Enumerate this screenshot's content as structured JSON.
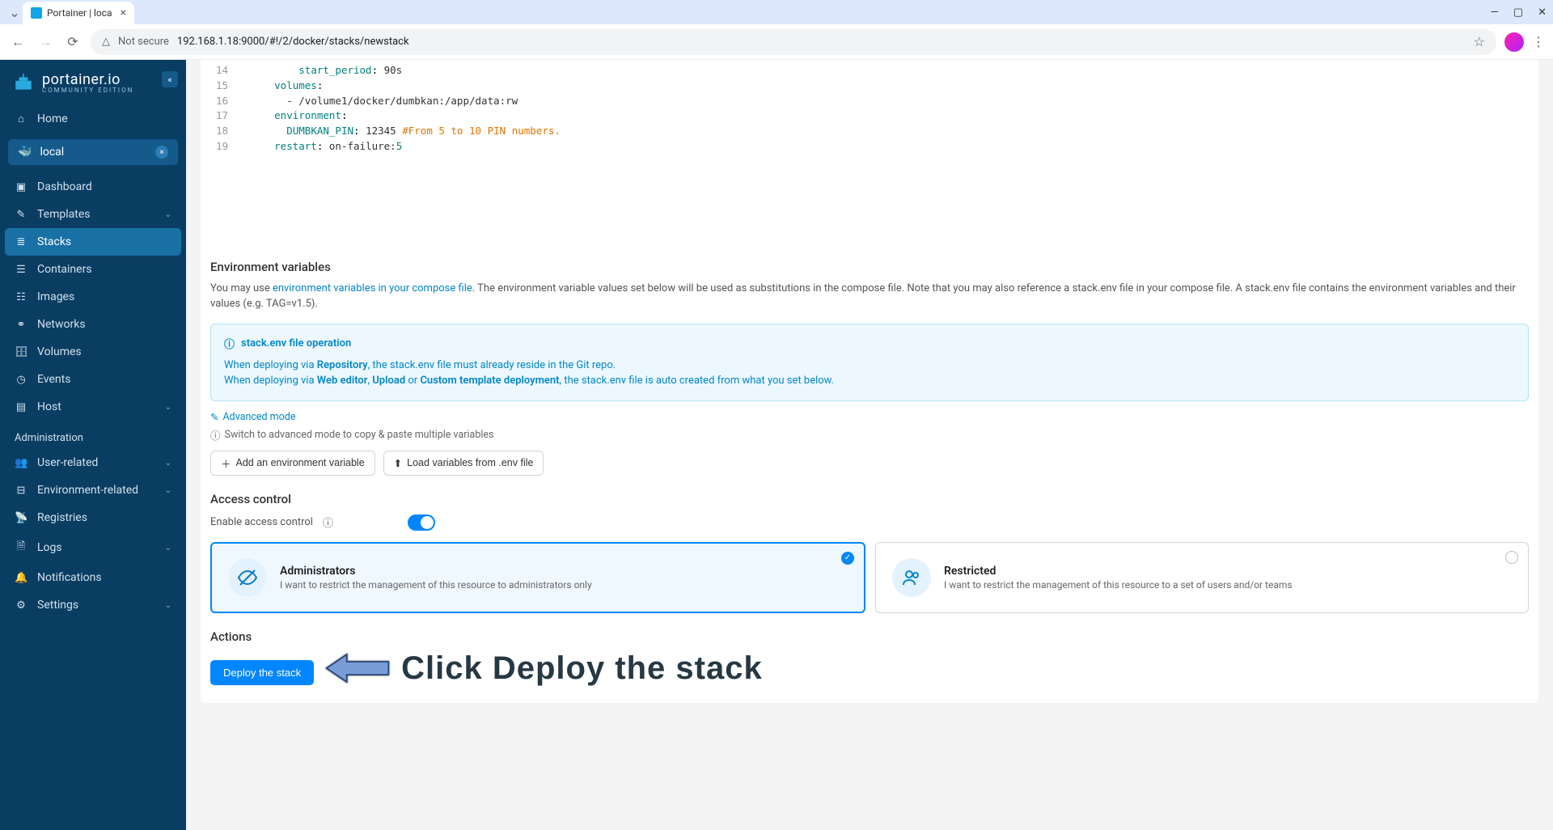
{
  "browser": {
    "tab_title": "Portainer | loca",
    "url_prefix": "Not secure",
    "url": "192.168.1.18:9000/#!/2/docker/stacks/newstack"
  },
  "logo": {
    "name": "portainer.io",
    "sub": "COMMUNITY EDITION"
  },
  "nav": {
    "home": "Home",
    "env": "local",
    "dashboard": "Dashboard",
    "templates": "Templates",
    "stacks": "Stacks",
    "containers": "Containers",
    "images": "Images",
    "networks": "Networks",
    "volumes": "Volumes",
    "events": "Events",
    "host": "Host",
    "admin_label": "Administration",
    "user_related": "User-related",
    "env_related": "Environment-related",
    "registries": "Registries",
    "logs": "Logs",
    "notifications": "Notifications",
    "settings": "Settings"
  },
  "code": [
    {
      "n": "14",
      "indent": "          ",
      "key": "start_period",
      "val": " 90s"
    },
    {
      "n": "15",
      "indent": "      ",
      "key": "volumes",
      "val": ""
    },
    {
      "n": "16",
      "indent": "        ",
      "raw": "- /volume1/docker/dumbkan:/app/data:rw"
    },
    {
      "n": "17",
      "indent": "      ",
      "key": "environment",
      "val": ""
    },
    {
      "n": "18",
      "indent": "        ",
      "key": "DUMBKAN_PIN",
      "val": " 12345 ",
      "cmt": "#From 5 to 10 PIN numbers."
    },
    {
      "n": "19",
      "indent": "      ",
      "key": "restart",
      "val": " on-failure:",
      "num": "5"
    }
  ],
  "env_section": {
    "title": "Environment variables",
    "help_pre": "You may use ",
    "help_link": "environment variables in your compose file",
    "help_post": ". The environment variable values set below will be used as substitutions in the compose file. Note that you may also reference a stack.env file in your compose file. A stack.env file contains the environment variables and their values (e.g. TAG=v1.5).",
    "info_title": "stack.env file operation",
    "info_l1_a": "When deploying via ",
    "info_l1_b": "Repository",
    "info_l1_c": ", the stack.env file must already reside in the Git repo.",
    "info_l2_a": "When deploying via ",
    "info_l2_b": "Web editor",
    "info_l2_c": ", ",
    "info_l2_d": "Upload",
    "info_l2_e": " or ",
    "info_l2_f": "Custom template deployment",
    "info_l2_g": ", the stack.env file is auto created from what you set below.",
    "adv_mode": "Advanced mode",
    "adv_hint": "Switch to advanced mode to copy & paste multiple variables",
    "add_btn": "Add an environment variable",
    "load_btn": "Load variables from .env file"
  },
  "access": {
    "title": "Access control",
    "enable": "Enable access control",
    "admin_title": "Administrators",
    "admin_desc": "I want to restrict the management of this resource to administrators only",
    "restricted_title": "Restricted",
    "restricted_desc": "I want to restrict the management of this resource to a set of users and/or teams"
  },
  "actions": {
    "title": "Actions",
    "deploy": "Deploy the stack"
  },
  "annotation": "Click Deploy the stack"
}
